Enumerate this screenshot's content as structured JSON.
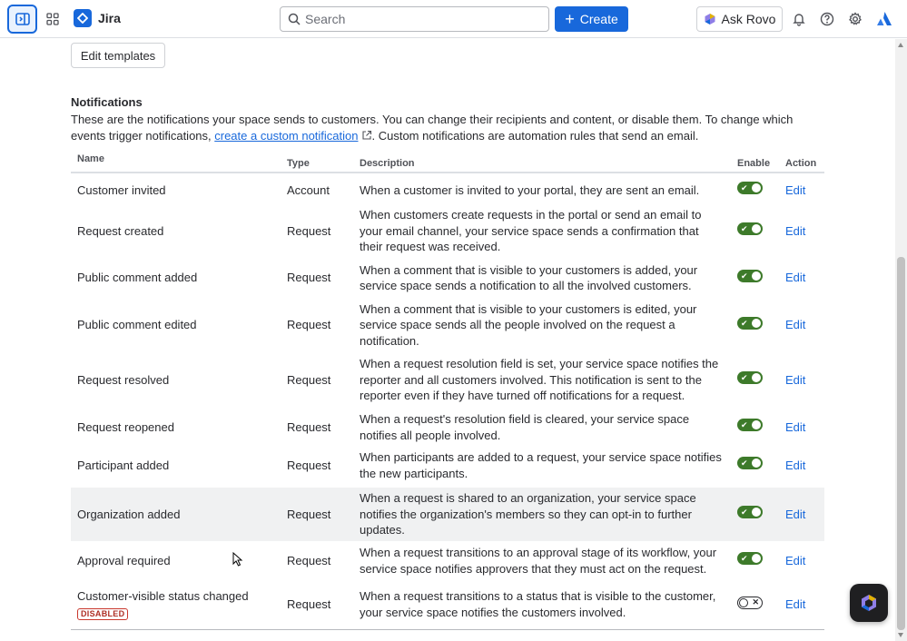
{
  "topbar": {
    "app_name": "Jira",
    "search_placeholder": "Search",
    "create_label": "Create",
    "rovo_label": "Ask Rovo"
  },
  "content": {
    "edit_templates_label": "Edit templates",
    "section_title": "Notifications",
    "desc_part1": "These are the notifications your space sends to customers. You can change their recipients and content, or disable them. To change which events trigger notifications, ",
    "desc_link": "create a custom notification",
    "desc_part2": ". Custom notifications are automation rules that send an email."
  },
  "table": {
    "headers": {
      "name": "Name",
      "type": "Type",
      "description": "Description",
      "enable": "Enable",
      "action": "Action"
    },
    "rows": [
      {
        "name": "Customer invited",
        "type": "Account",
        "description": "When a customer is invited to your portal, they are sent an email.",
        "enabled": true,
        "action": "Edit"
      },
      {
        "name": "Request created",
        "type": "Request",
        "description": "When customers create requests in the portal or send an email to your email channel, your service space sends a confirmation that their request was received.",
        "enabled": true,
        "action": "Edit"
      },
      {
        "name": "Public comment added",
        "type": "Request",
        "description": "When a comment that is visible to your customers is added, your service space sends a notification to all the involved customers.",
        "enabled": true,
        "action": "Edit"
      },
      {
        "name": "Public comment edited",
        "type": "Request",
        "description": "When a comment that is visible to your customers is edited, your service space sends all the people involved on the request a notification.",
        "enabled": true,
        "action": "Edit"
      },
      {
        "name": "Request resolved",
        "type": "Request",
        "description": "When a request resolution field is set, your service space notifies the reporter and all customers involved. This notification is sent to the reporter even if they have turned off notifications for a request.",
        "enabled": true,
        "action": "Edit"
      },
      {
        "name": "Request reopened",
        "type": "Request",
        "description": "When a request's resolution field is cleared, your service space notifies all people involved.",
        "enabled": true,
        "action": "Edit"
      },
      {
        "name": "Participant added",
        "type": "Request",
        "description": "When participants are added to a request, your service space notifies the new participants.",
        "enabled": true,
        "action": "Edit"
      },
      {
        "name": "Organization added",
        "type": "Request",
        "description": "When a request is shared to an organization, your service space notifies the organization's members so they can opt-in to further updates.",
        "enabled": true,
        "action": "Edit"
      },
      {
        "name": "Approval required",
        "type": "Request",
        "description": "When a request transitions to an approval stage of its workflow, your service space notifies approvers that they must act on the request.",
        "enabled": true,
        "action": "Edit"
      },
      {
        "name": "Customer-visible status changed",
        "badge": "DISABLED",
        "type": "Request",
        "description": "When a request transitions to a status that is visible to the customer, your service space notifies the customers involved.",
        "enabled": false,
        "action": "Edit"
      }
    ]
  },
  "colors": {
    "accent": "#1868db",
    "toggle_on": "#3d7a2a",
    "badge_red": "#ae2e24"
  }
}
